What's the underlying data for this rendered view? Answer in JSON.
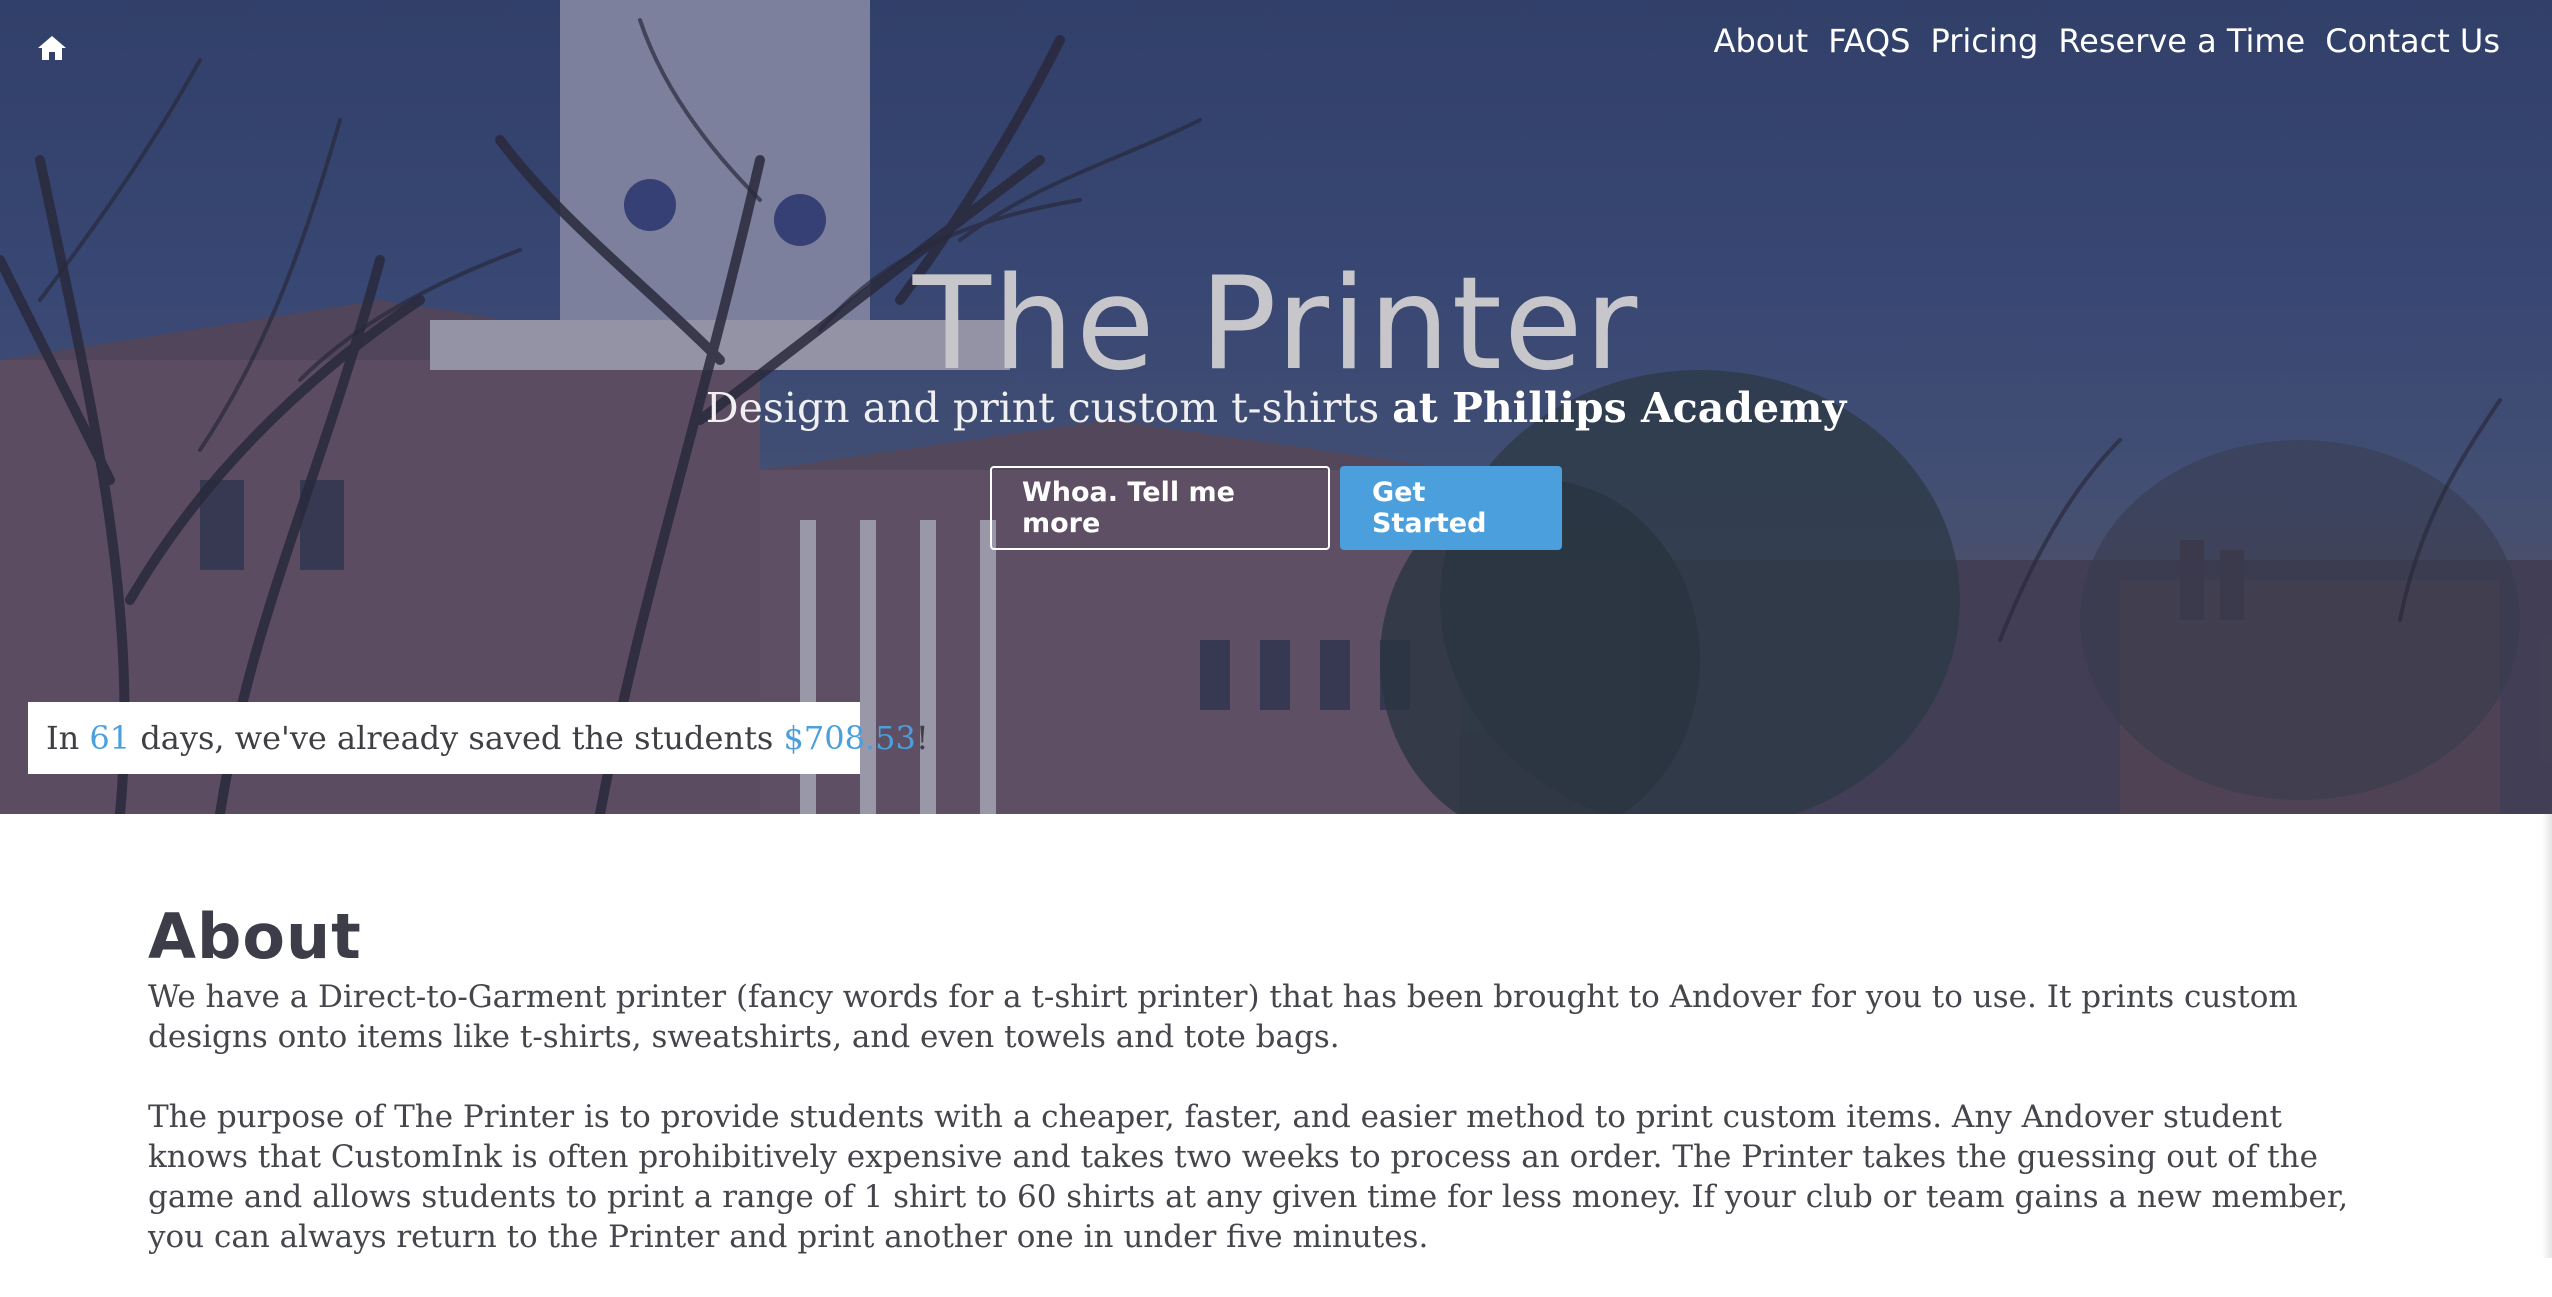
{
  "nav": {
    "home_icon": "home-icon",
    "links": [
      "About",
      "FAQS",
      "Pricing",
      "Reserve a Time",
      "Contact Us"
    ]
  },
  "hero": {
    "title": "The Printer",
    "subtitle_plain": "Design and print custom t-shirts ",
    "subtitle_strong": "at Phillips Academy",
    "button_more": "Whoa. Tell me more",
    "button_start": "Get Started"
  },
  "savings": {
    "prefix": "In ",
    "days": "61",
    "middle": " days, we've already saved the students ",
    "amount": "$708.53",
    "suffix": "!"
  },
  "about": {
    "heading": "About",
    "paragraph1": "We have a Direct-to-Garment printer (fancy words for a t-shirt printer) that has been brought to Andover for you to use. It prints custom designs onto items like t-shirts, sweatshirts, and even towels and tote bags.",
    "paragraph2": "The purpose of The Printer is to provide students with a cheaper, faster, and easier method to print custom items. Any Andover student knows that CustomInk is often prohibitively expensive and takes two weeks to process an order. The Printer takes the guessing out of the game and allows students to print a range of 1 shirt to 60 shirts at any given time for less money. If your club or team gains a new member, you can always return to the Printer and print another one in under five minutes."
  },
  "colors": {
    "accent": "#4a9fdc",
    "hero_overlay": "#34436a",
    "heading": "#3c3d48"
  }
}
